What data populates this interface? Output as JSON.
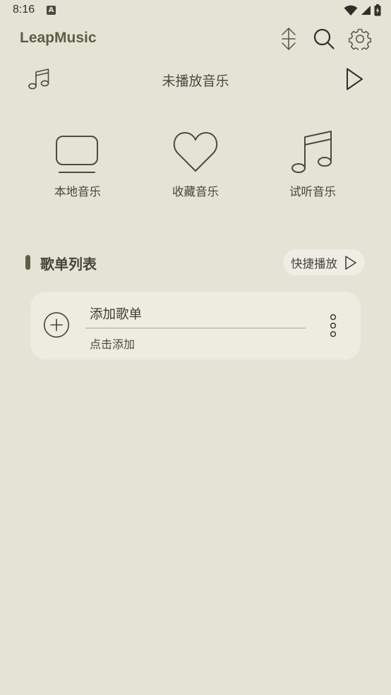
{
  "status_bar": {
    "time": "8:16",
    "notification_glyph": "A",
    "icons": [
      "wifi-icon",
      "cellular-icon",
      "battery-charging-icon"
    ]
  },
  "header": {
    "title": "LeapMusic",
    "actions": [
      "sort-icon",
      "search-icon",
      "settings-icon"
    ]
  },
  "now_playing": {
    "title": "未播放音乐",
    "left_icon": "music-note-icon",
    "right_icon": "play-icon"
  },
  "categories": [
    {
      "label": "本地音乐",
      "icon": "tv-icon"
    },
    {
      "label": "收藏音乐",
      "icon": "heart-icon"
    },
    {
      "label": "试听音乐",
      "icon": "music-notes-icon"
    }
  ],
  "playlist_section": {
    "title": "歌单列表",
    "quick_play_label": "快捷播放"
  },
  "playlists": [
    {
      "title": "添加歌单",
      "subtitle": "点击添加"
    }
  ],
  "colors": {
    "background": "#e5e3d5",
    "accent": "#5d5d45",
    "card": "#edece0",
    "icon": "#45453c"
  }
}
